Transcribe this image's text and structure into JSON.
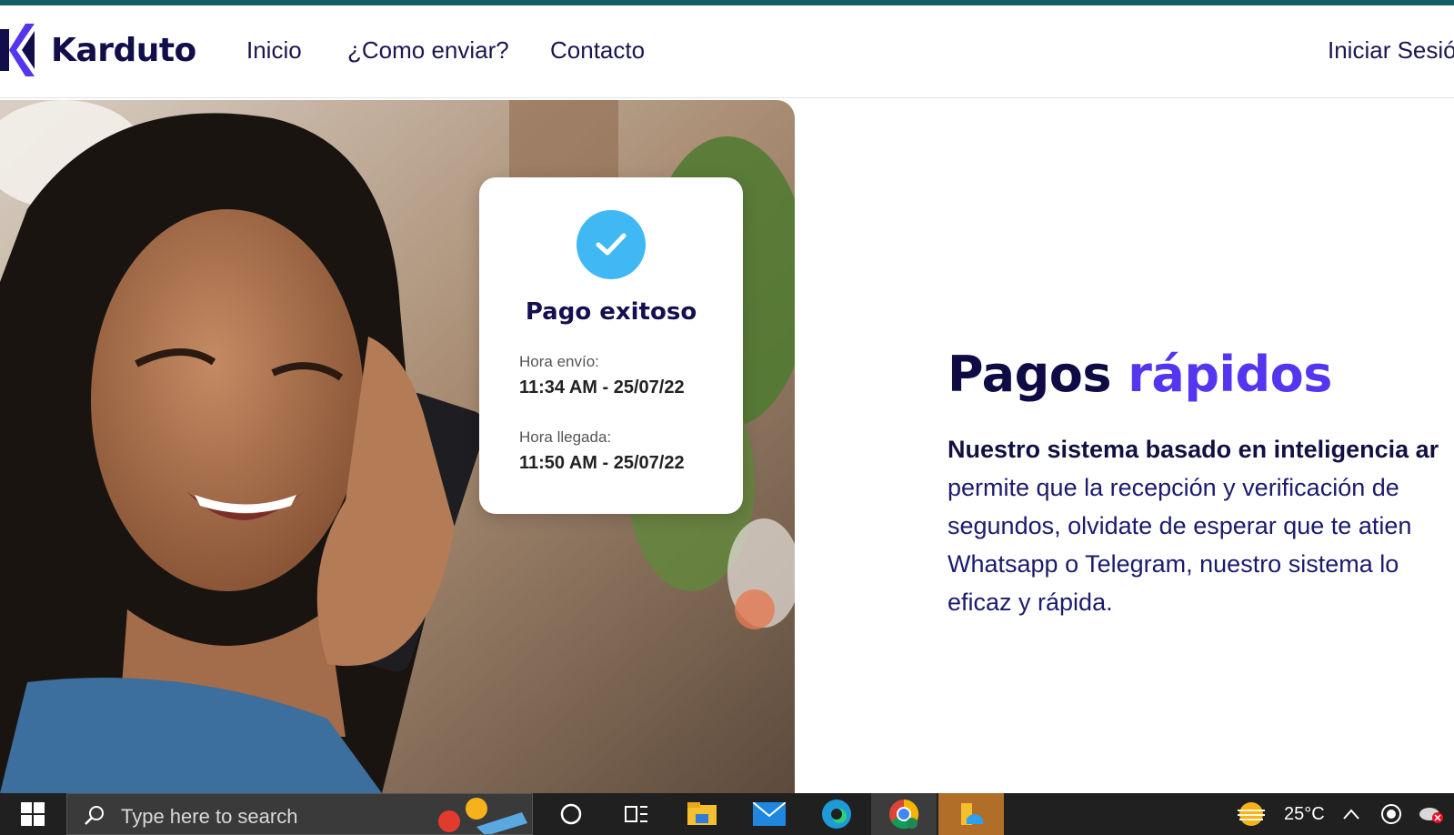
{
  "brand": {
    "name": "Karduto",
    "accent_color": "#5436f0",
    "dark_color": "#0e0b45"
  },
  "nav": {
    "items": [
      "Inicio",
      "¿Como enviar?",
      "Contacto"
    ],
    "login": "Iniciar Sesió"
  },
  "card": {
    "title": "Pago exitoso",
    "sent_label": "Hora envío:",
    "sent_value": "11:34 AM - 25/07/22",
    "arrival_label": "Hora llegada:",
    "arrival_value": "11:50 AM - 25/07/22"
  },
  "section": {
    "title_main": "Pagos",
    "title_accent": "rápidos",
    "lines": [
      "Nuestro sistema basado en inteligencia ar",
      "permite que la recepción y verificación de",
      "segundos, olvidate de esperar que te atien",
      "Whatsapp o Telegram, nuestro sistema lo",
      "eficaz y rápida."
    ]
  },
  "taskbar": {
    "search_placeholder": "Type here to search",
    "temperature": "25°C",
    "icons": [
      "windows-start-icon",
      "cortana-icon",
      "task-view-icon",
      "file-explorer-icon",
      "mail-icon",
      "edge-icon",
      "chrome-icon",
      "files-app-icon"
    ]
  }
}
